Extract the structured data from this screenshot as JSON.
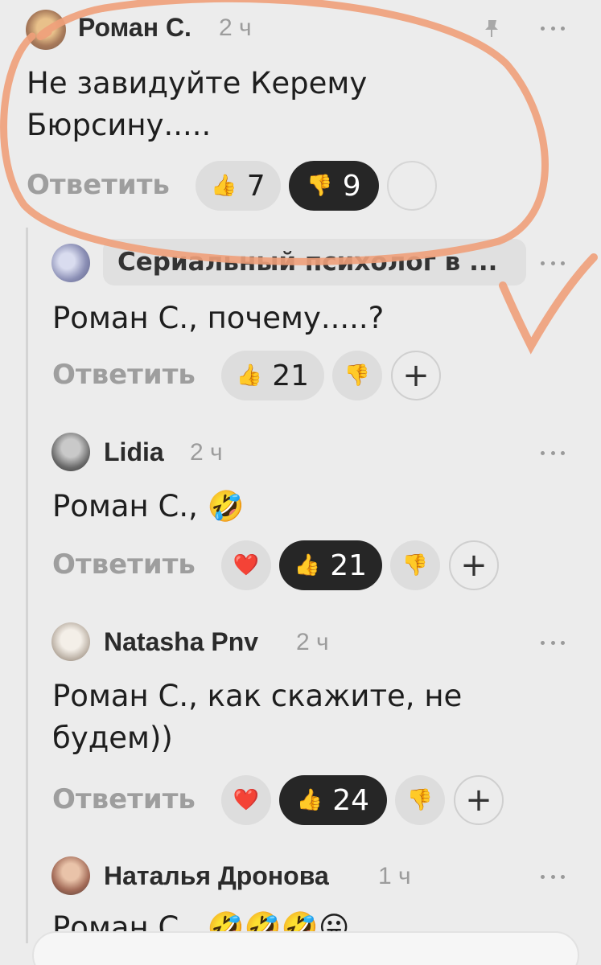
{
  "comments": [
    {
      "author": "Роман С.",
      "time": "2 ч",
      "text": "Не завидуйте Керему Бюрсину.....",
      "reply_label": "Ответить",
      "likes": "7",
      "dislikes": "9"
    },
    {
      "author": "Сериальный  психолог в ...",
      "text": "Роман С., почему.....?",
      "reply_label": "Ответить",
      "likes": "21",
      "add_label": "+"
    },
    {
      "author": "Lidia",
      "time": "2 ч",
      "text": "Роман С., 🤣",
      "reply_label": "Ответить",
      "likes": "21",
      "add_label": "+"
    },
    {
      "author": "Natasha Pnv",
      "time": "2 ч",
      "text": "Роман С., как скажите, не будем))",
      "reply_label": "Ответить",
      "likes": "24",
      "add_label": "+"
    },
    {
      "author": "Наталья Дронова",
      "time": "1 ч",
      "text": "Роман С., 🤣🤣🤣😛"
    }
  ],
  "icons": {
    "like": "thumbs-up-icon",
    "dislike": "thumbs-down-icon",
    "pin": "pin-icon",
    "more": "more-dots-icon",
    "reaction": "heart-reaction-icon"
  },
  "colors": {
    "background": "#ececec",
    "pill": "#dddddd",
    "pill_active": "#262626",
    "annotation": "#f0a07a"
  }
}
